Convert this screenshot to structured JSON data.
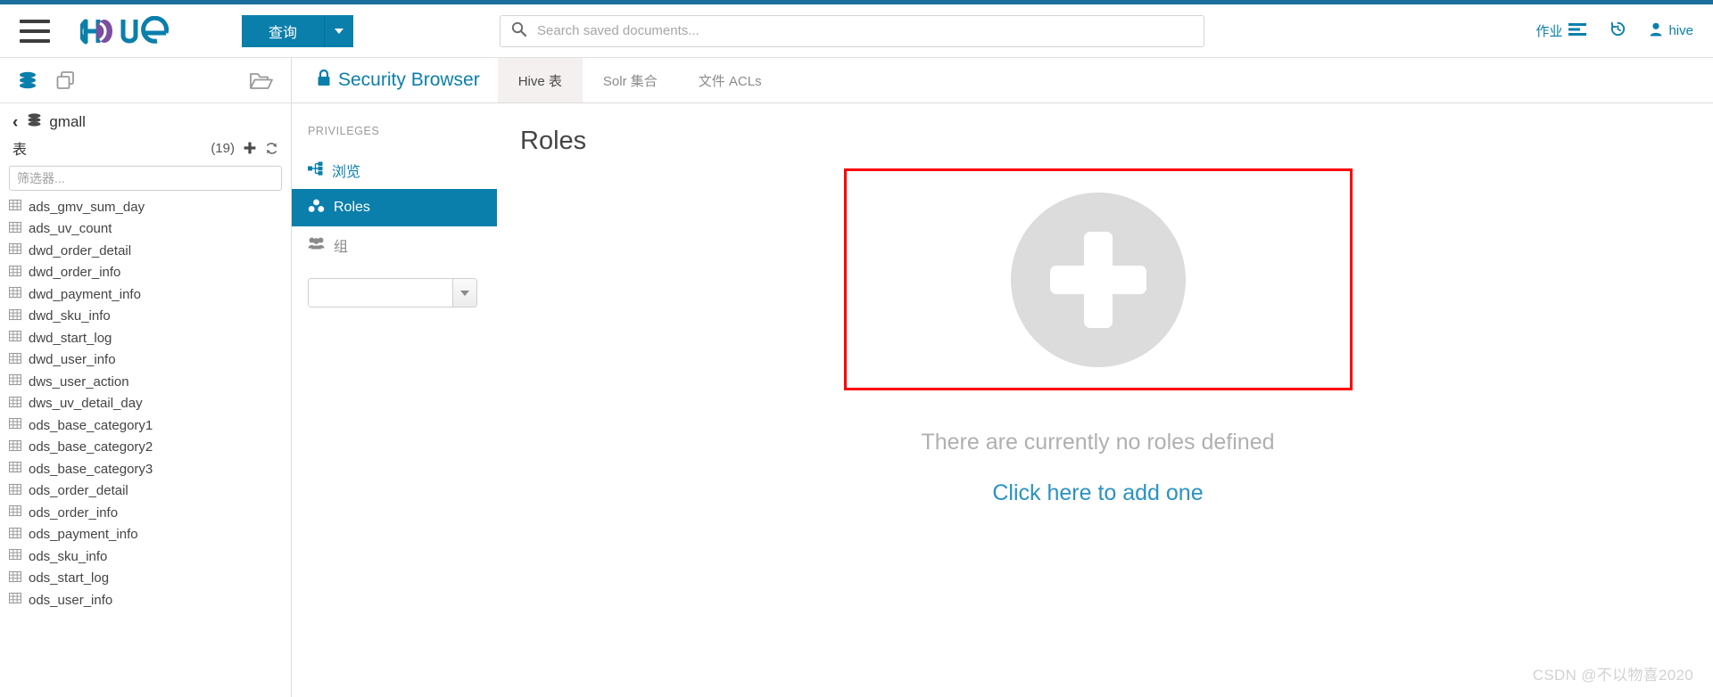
{
  "header": {
    "menu_icon": "hamburger-icon",
    "logo_text": "hue",
    "query_button": "查询",
    "query_caret": "chevron-down-icon",
    "search": {
      "icon": "search-icon",
      "placeholder": "Search saved documents...",
      "value": ""
    },
    "right_items": [
      {
        "label": "作业",
        "icon": "jobs-icon"
      },
      {
        "label": "",
        "icon": "history-icon"
      },
      {
        "label": "hive",
        "icon": "user-icon"
      }
    ]
  },
  "assist": {
    "top_icons": [
      {
        "name": "database-icon"
      },
      {
        "name": "documents-icon"
      },
      {
        "name": "open-folder-icon"
      }
    ],
    "database": {
      "back_icon": "chevron-left-icon",
      "db_icon": "database-icon",
      "name": "gmall"
    },
    "tables_label": "表",
    "tables_count": "(19)",
    "add_icon": "plus-icon",
    "refresh_icon": "refresh-icon",
    "filter_placeholder": "筛选器...",
    "filter_value": "",
    "tables": [
      "ads_gmv_sum_day",
      "ads_uv_count",
      "dwd_order_detail",
      "dwd_order_info",
      "dwd_payment_info",
      "dwd_sku_info",
      "dwd_start_log",
      "dwd_user_info",
      "dws_user_action",
      "dws_uv_detail_day",
      "ods_base_category1",
      "ods_base_category2",
      "ods_base_category3",
      "ods_order_detail",
      "ods_order_info",
      "ods_payment_info",
      "ods_sku_info",
      "ods_start_log",
      "ods_user_info"
    ]
  },
  "security": {
    "title": "Security Browser",
    "title_icon": "lock-icon",
    "tabs": [
      {
        "label": "Hive 表",
        "active": true
      },
      {
        "label": "Solr 集合",
        "active": false
      },
      {
        "label": "文件 ACLs",
        "active": false
      }
    ],
    "privileges_header": "PRIVILEGES",
    "nav": [
      {
        "label": "浏览",
        "icon": "sitemap-icon",
        "active": false
      },
      {
        "label": "Roles",
        "icon": "cubes-icon",
        "active": true
      },
      {
        "label": "组",
        "icon": "group-icon",
        "active": false
      }
    ],
    "group_select": {
      "value": "",
      "caret": "chevron-down-icon"
    }
  },
  "content": {
    "title": "Roles",
    "add_icon": "plus-circle-icon",
    "empty_message": "There are currently no roles defined",
    "add_link": "Click here to add one",
    "highlight_color": "#ff0000"
  },
  "watermark": "CSDN @不以物喜2020",
  "colors": {
    "brand_blue": "#0b7fab",
    "top_strip": "#1b6f9c",
    "link_blue": "#2a92c4",
    "muted": "#b0b0b0"
  }
}
